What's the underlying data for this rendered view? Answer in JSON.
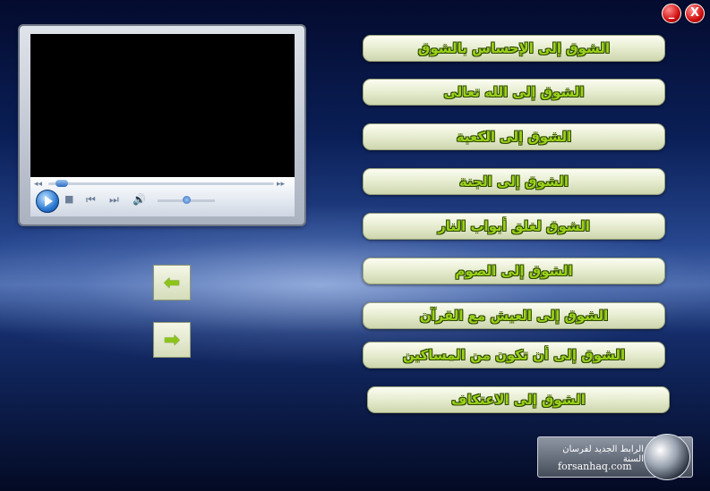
{
  "window_controls": {
    "minimize": "_",
    "close": "X"
  },
  "player": {
    "progress": 0.03,
    "volume": 0.5,
    "icons": [
      "play-icon",
      "stop-icon",
      "previous-icon",
      "next-icon",
      "volume-icon"
    ]
  },
  "menu": [
    "الشوق إلى الإحساس بالشوق",
    "الشوق إلى الله تعالى",
    "الشوق إلى الكعبة",
    "الشوق إلى الجنة",
    "الشوق لغلق أبواب النار",
    "الشوق إلى الصوم",
    "الشوق إلى العيش مع القرآن",
    "الشوق إلى أن تكون من المساكين",
    "الشوق إلى الاعتكاف"
  ],
  "nav": {
    "back_icon": "arrow-left-icon",
    "forward_icon": "arrow-right-icon"
  },
  "logo": {
    "title": "الرابط الجديد لفرسان السنة",
    "url": "forsanhaq.com"
  },
  "colors": {
    "button_text": "#9ad21a",
    "button_outline": "#2e4700",
    "close": "#d11010"
  }
}
